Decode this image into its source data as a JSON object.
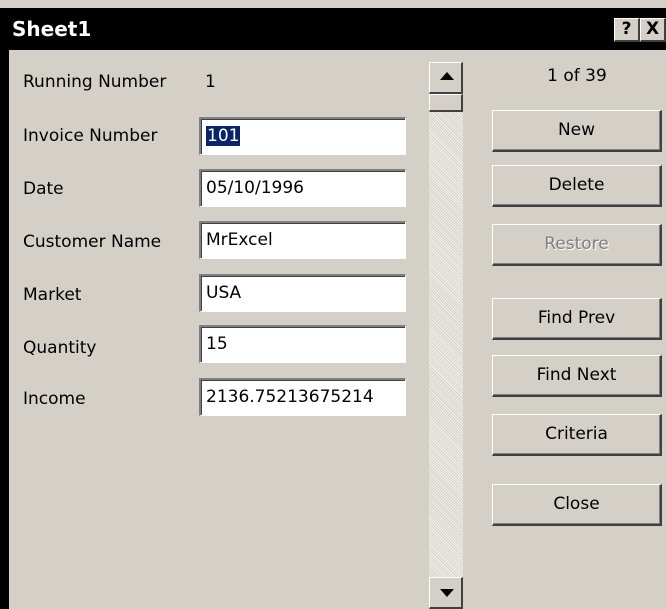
{
  "window": {
    "title": "Sheet1",
    "help_label": "?",
    "close_label": "X"
  },
  "form": {
    "running_number": {
      "label": "Running Number",
      "value": "1"
    },
    "fields": [
      {
        "label": "Invoice Number",
        "value": "101"
      },
      {
        "label": "Date",
        "value": "05/10/1996"
      },
      {
        "label": "Customer Name",
        "value": "MrExcel"
      },
      {
        "label": "Market",
        "value": "USA"
      },
      {
        "label": "Quantity",
        "value": "15"
      },
      {
        "label": "Income",
        "value": "2136.75213675214"
      }
    ]
  },
  "record_position": "1 of 39",
  "buttons": {
    "new": "New",
    "delete": "Delete",
    "restore": "Restore",
    "find_prev": "Find Prev",
    "find_next": "Find Next",
    "criteria": "Criteria",
    "close": "Close"
  },
  "icons": {
    "scroll_up": "up-arrow-icon",
    "scroll_down": "down-arrow-icon"
  }
}
